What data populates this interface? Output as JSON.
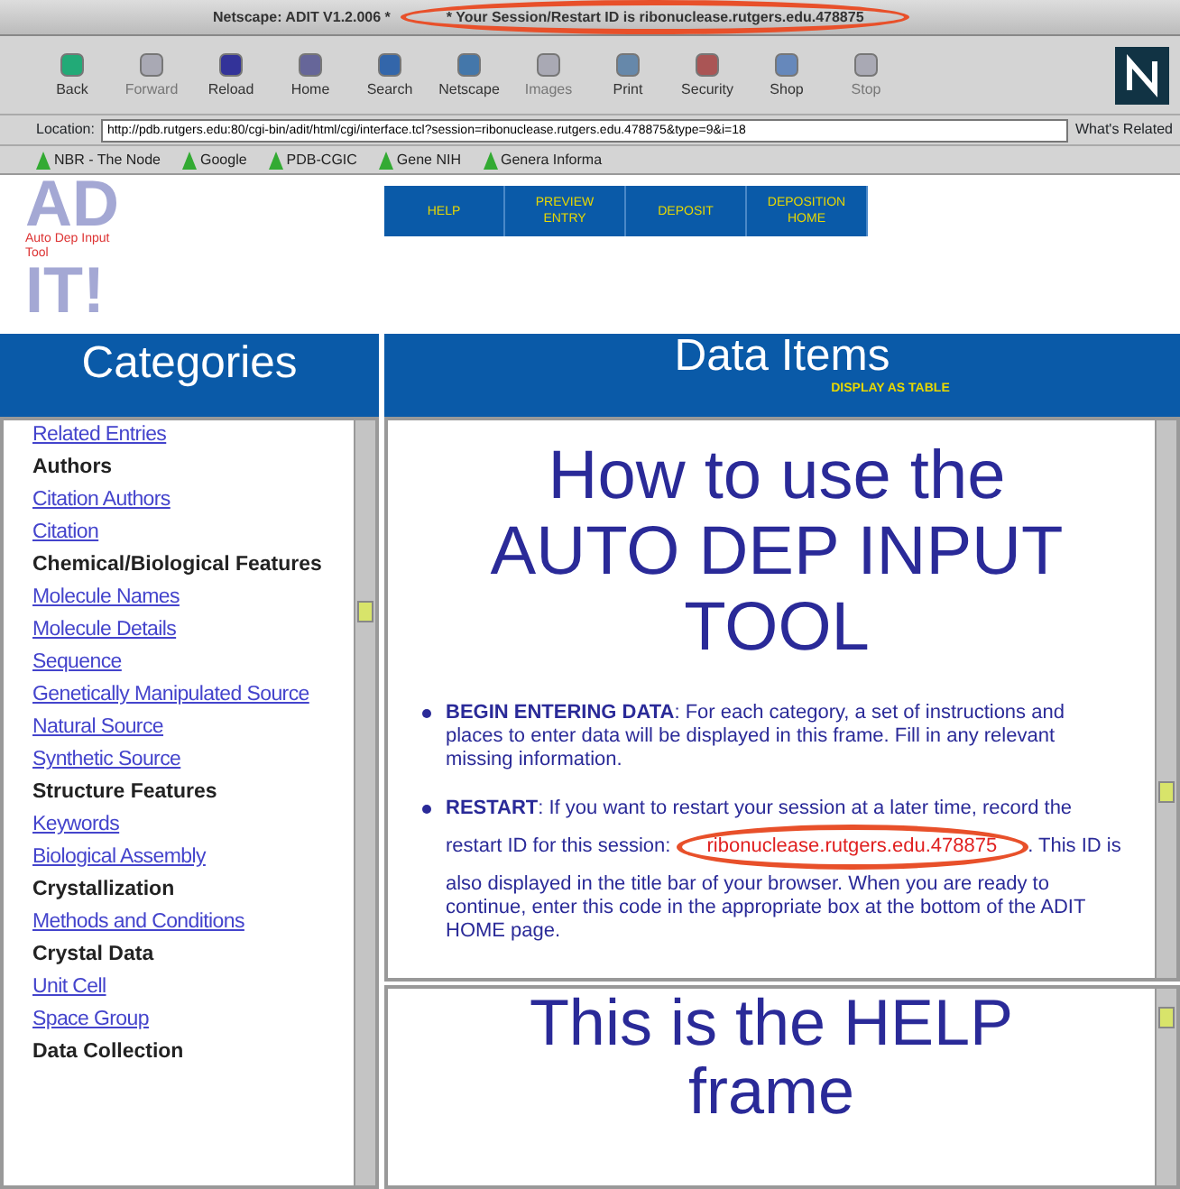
{
  "window": {
    "title": "Netscape: ADIT V1.2.006 *",
    "title_extra": "* Your Session/Restart ID is ribonuclease.rutgers.edu.478875"
  },
  "toolbar": [
    {
      "label": "Back",
      "disabled": false
    },
    {
      "label": "Forward",
      "disabled": true
    },
    {
      "label": "Reload",
      "disabled": false
    },
    {
      "label": "Home",
      "disabled": false
    },
    {
      "label": "Search",
      "disabled": false
    },
    {
      "label": "Netscape",
      "disabled": false
    },
    {
      "label": "Images",
      "disabled": true
    },
    {
      "label": "Print",
      "disabled": false
    },
    {
      "label": "Security",
      "disabled": false
    },
    {
      "label": "Shop",
      "disabled": false
    },
    {
      "label": "Stop",
      "disabled": true
    }
  ],
  "location": {
    "label": "Location:",
    "value": "http://pdb.rutgers.edu:80/cgi-bin/adit/html/cgi/interface.tcl?session=ribonuclease.rutgers.edu.478875&type=9&i=18",
    "related": "What's Related"
  },
  "bookmarks": [
    "NBR - The Node",
    "Google",
    "PDB-CGIC",
    "Gene NIH",
    "Genera Informa"
  ],
  "logo": {
    "letters_top": "AD",
    "letters_bottom": "IT!",
    "subtitle": "Auto Dep Input Tool"
  },
  "nav": [
    "HELP",
    "PREVIEW ENTRY",
    "DEPOSIT",
    "DEPOSITION HOME"
  ],
  "categories": {
    "title": "Categories",
    "items": [
      {
        "kind": "link",
        "label": "Related Entries"
      },
      {
        "kind": "heading",
        "label": "Authors"
      },
      {
        "kind": "link",
        "label": "Citation Authors"
      },
      {
        "kind": "link",
        "label": "Citation"
      },
      {
        "kind": "heading",
        "label": "Chemical/Biological Features"
      },
      {
        "kind": "link",
        "label": "Molecule Names"
      },
      {
        "kind": "link",
        "label": "Molecule Details"
      },
      {
        "kind": "link",
        "label": "Sequence"
      },
      {
        "kind": "link",
        "label": "Genetically Manipulated Source"
      },
      {
        "kind": "link",
        "label": "Natural Source"
      },
      {
        "kind": "link",
        "label": "Synthetic Source"
      },
      {
        "kind": "heading",
        "label": "Structure Features"
      },
      {
        "kind": "link",
        "label": "Keywords"
      },
      {
        "kind": "link",
        "label": "Biological Assembly"
      },
      {
        "kind": "heading",
        "label": "Crystallization"
      },
      {
        "kind": "link",
        "label": "Methods and Conditions"
      },
      {
        "kind": "heading",
        "label": "Crystal Data"
      },
      {
        "kind": "link",
        "label": "Unit Cell"
      },
      {
        "kind": "link",
        "label": "Space Group"
      },
      {
        "kind": "heading",
        "label": "Data Collection"
      }
    ]
  },
  "data_items": {
    "title": "Data Items",
    "display_link": "DISPLAY AS TABLE"
  },
  "instructions": {
    "heading": "How to use the AUTO DEP INPUT TOOL",
    "bullets": [
      {
        "lead": "BEGIN ENTERING DATA",
        "text": ": For each category, a set of instructions and places to enter data will be displayed in this frame. Fill in any relevant missing information."
      },
      {
        "lead": "RESTART",
        "text": ": If you want to restart your session at a later time, record the restart ID for this session: ",
        "session_id": "ribonuclease.rutgers.edu.478875",
        "text_after": ". This ID is also displayed in the title bar of your browser. When you are ready to continue, enter this code in the appropriate box at the bottom of the ADIT HOME page."
      }
    ]
  },
  "help_frame": {
    "text": "This is the HELP frame"
  }
}
